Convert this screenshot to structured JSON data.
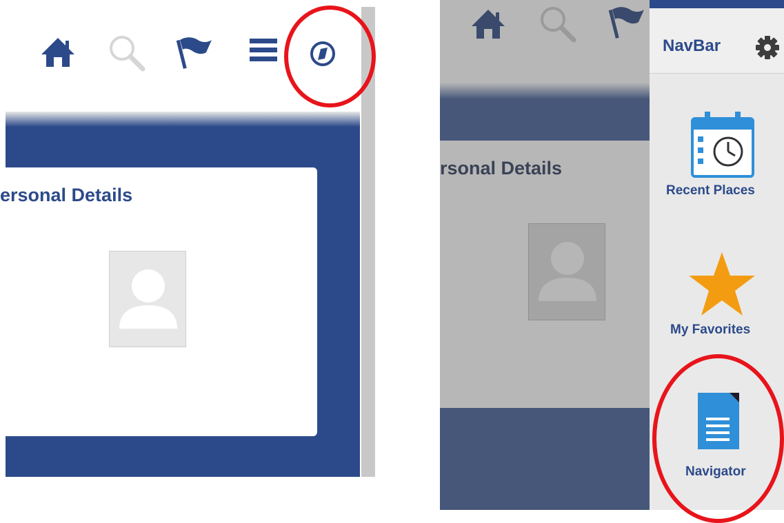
{
  "left_screenshot": {
    "card_title": "ersonal Details",
    "header_icons": [
      "home-icon",
      "search-icon",
      "flag-icon",
      "menu-icon",
      "navbar-compass-icon"
    ],
    "highlighted": "navbar-compass-icon"
  },
  "right_screenshot": {
    "card_title": "rsonal Details",
    "navbar": {
      "title": "NavBar",
      "settings_icon": "gear-icon",
      "items": [
        {
          "label": "Recent Places",
          "icon": "calendar-clock-icon"
        },
        {
          "label": "My Favorites",
          "icon": "star-icon"
        },
        {
          "label": "Navigator",
          "icon": "document-icon"
        }
      ]
    },
    "highlighted": "Navigator"
  },
  "colors": {
    "brand_blue": "#2c4a8a",
    "annotation_red": "#e8141b",
    "star_orange": "#f39c12",
    "doc_blue": "#2f8fd8"
  }
}
